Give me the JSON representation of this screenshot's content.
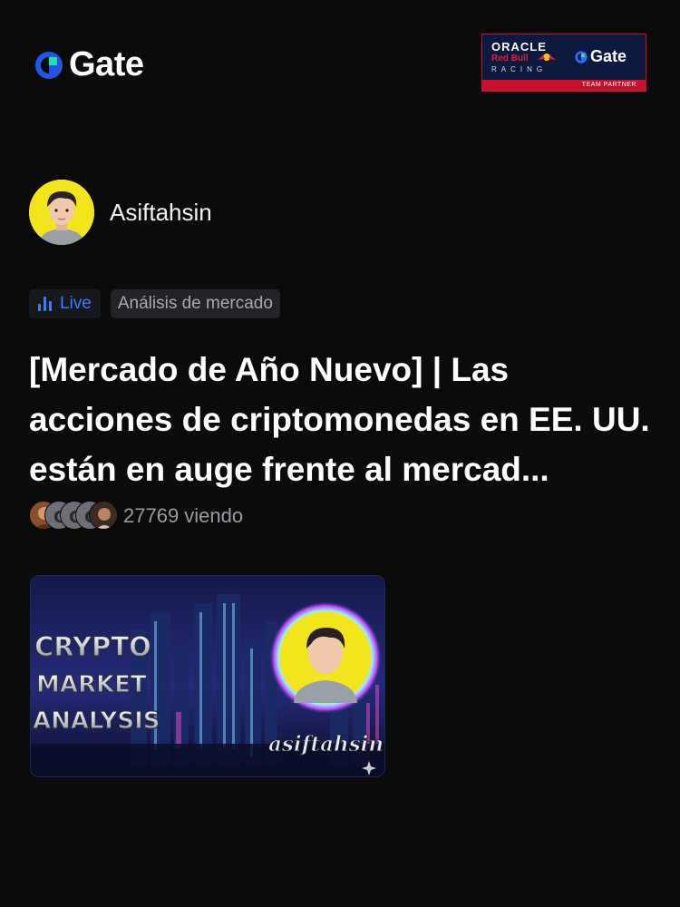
{
  "header": {
    "brand": "Gate",
    "partner": {
      "line1": "ORACLE",
      "line2": "Red Bull",
      "line3": "RACING",
      "brand": "Gate",
      "ribbon": "TEAM PARTNER"
    }
  },
  "author": {
    "name": "Asiftahsin"
  },
  "tags": {
    "live": "Live",
    "category": "Análisis de mercado"
  },
  "post": {
    "title": "[Mercado de Año Nuevo] | Las acciones de criptomonedas en EE. UU. están en auge frente al mercad...",
    "viewers": "27769 viendo"
  },
  "thumbnail": {
    "line1": "CRYPTO",
    "line2": "MARKET",
    "line3": "ANALYSIS",
    "handle": "asiftahsin"
  },
  "colors": {
    "background": "#0b0b0c",
    "gate_blue": "#2354e6",
    "gate_green": "#17e5a0",
    "live_blue": "#3d7cff",
    "avatar_yellow": "#f3e51b",
    "partner_red": "#c8102e",
    "partner_navy": "#0e1a3d"
  }
}
